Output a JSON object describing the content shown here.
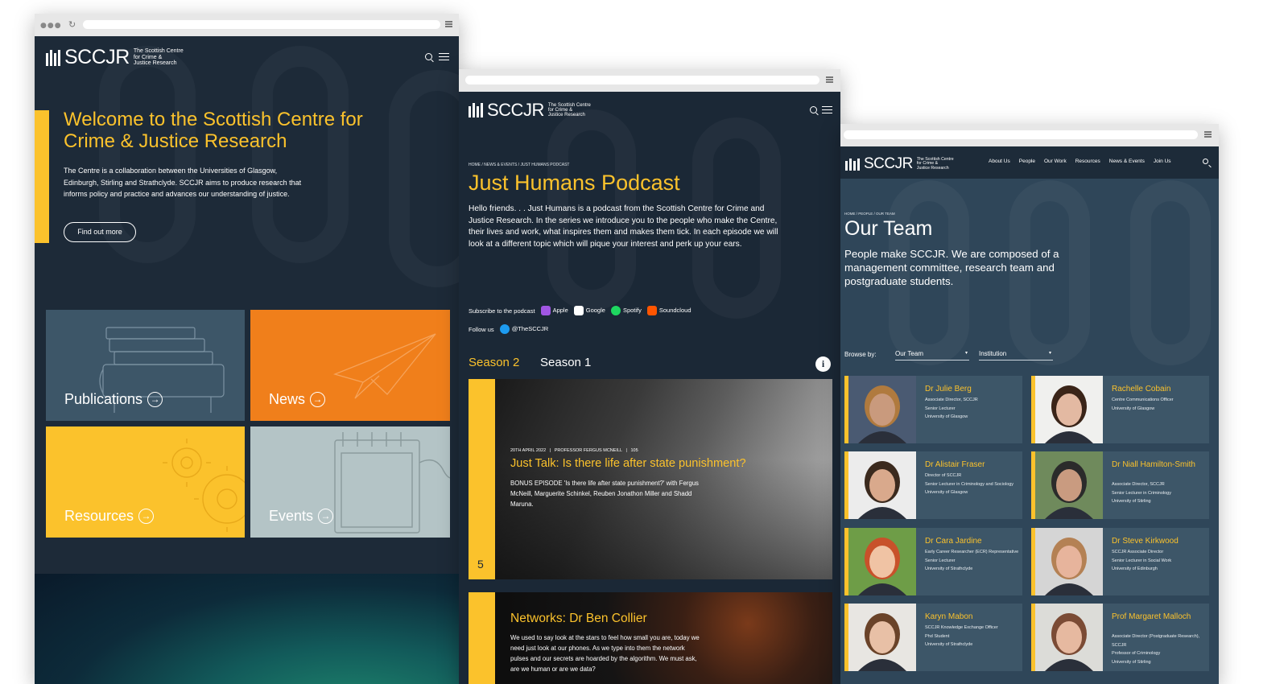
{
  "left": {
    "logo_word": "SCCJR",
    "logo_tag": "The Scottish Centre\nfor Crime &\nJustice Research",
    "heading": "Welcome to the Scottish Centre for Crime & Justice Research",
    "body": "The Centre is a collaboration between the Universities of Glasgow, Edinburgh, Stirling and Strathclyde. SCCJR aims to produce research that informs policy and practice and advances our understanding of justice.",
    "button": "Find out more",
    "tiles": [
      {
        "label": "Publications",
        "icon": "books-icon",
        "color": "#3d5668"
      },
      {
        "label": "News",
        "icon": "paper-plane-icon",
        "color": "#f07f1b"
      },
      {
        "label": "Resources",
        "icon": "gears-icon",
        "color": "#fbc22c"
      },
      {
        "label": "Events",
        "icon": "notepad-icon",
        "color": "#b4c4c6"
      }
    ]
  },
  "middle": {
    "logo_word": "SCCJR",
    "logo_tag": "The Scottish Centre\nfor Crime &\nJustice Research",
    "breadcrumb": "HOME / NEWS & EVENTS / JUST HUMANS PODCAST",
    "title": "Just Humans Podcast",
    "intro": "Hello friends. . . Just Humans is a podcast from the Scottish Centre for Crime and Justice Research. In the series we introduce you to the people who make the Centre, their lives and work, what inspires them and makes them tick. In each episode we will look at a different topic which will pique your interest and perk up your ears.",
    "subscribe_label": "Subscribe to the podcast",
    "platforms": [
      {
        "name": "Apple",
        "icon": "apple-podcasts-icon",
        "color": "#a056e3"
      },
      {
        "name": "Google",
        "icon": "google-podcasts-icon",
        "color": "#ffffff"
      },
      {
        "name": "Spotify",
        "icon": "spotify-icon",
        "color": "#1ed760"
      },
      {
        "name": "Soundcloud",
        "icon": "soundcloud-icon",
        "color": "#ff5500"
      }
    ],
    "follow_label": "Follow us",
    "twitter_handle": "@TheSCCJR",
    "season_active": "Season 2",
    "season_other": "Season 1",
    "episode1": {
      "meta": "20TH APRIL 2022   |   PROFESSOR FERGUS MCNEILL   |   105",
      "title": "Just Talk: Is there life after state punishment?",
      "desc": "BONUS EPISODE 'Is there life after state punishment?' with Fergus McNeill, Marguerite Schinkel, Reuben Jonathon Miller and Shadd Maruna.",
      "number": "5"
    },
    "episode2": {
      "title": "Networks: Dr Ben Collier",
      "desc": "We used to say look at the stars to feel how small you are, today we need just look at our phones. As we type into them the network pulses and our secrets are hoarded by the algorithm. We must ask, are we human or are we data?"
    }
  },
  "right": {
    "logo_word": "SCCJR",
    "logo_tag": "The Scottish Centre\nfor Crime &\nJustice Research",
    "nav": [
      "About Us",
      "People",
      "Our Work",
      "Resources",
      "News & Events",
      "Join Us"
    ],
    "breadcrumb": "HOME / PEOPLE / OUR TEAM",
    "title": "Our Team",
    "intro": "People make SCCJR. We are composed of a management committee, research team and postgraduate students.",
    "browse_label": "Browse by:",
    "filter1": "Our Team",
    "filter2": "Institution",
    "team": [
      {
        "name": "Dr Julie Berg",
        "role": "Associate Director, SCCJR\nSenior Lecturer\nUniversity of Glasgow",
        "skin": "#c99a7d",
        "hair": "#b07a3e",
        "bg": "#4a5a72"
      },
      {
        "name": "Rachelle Cobain",
        "role": "Centre Communications Officer\nUniversity of Glasgow",
        "skin": "#e3b9a2",
        "hair": "#3a2418",
        "bg": "#f0f0ee"
      },
      {
        "name": "Dr Alistair Fraser",
        "role": "Director of SCCJR\nSenior Lecturer in Criminology and Sociology\nUniversity of Glasgow",
        "skin": "#d9a98c",
        "hair": "#3b2a1e",
        "bg": "#ececec"
      },
      {
        "name": "Dr Niall Hamilton-Smith",
        "role": "Associate Director, SCCJR\nSenior Lecturer in Criminology\nUniversity of Stirling",
        "skin": "#c99b80",
        "hair": "#2b2b2b",
        "bg": "#6f8a5c"
      },
      {
        "name": "Dr Cara Jardine",
        "role": "Early Career Researcher (ECR) Representative\nSenior Lecturer\nUniversity of Strathclyde",
        "skin": "#f0c3a4",
        "hair": "#c8512a",
        "bg": "#6e9d47"
      },
      {
        "name": "Dr Steve Kirkwood",
        "role": "SCCJR Associate Director\nSenior Lecturer in Social Work\nUniversity of Edinburgh",
        "skin": "#e7b49c",
        "hair": "#b48154",
        "bg": "#d5d5d5"
      },
      {
        "name": "Karyn Mabon",
        "role": "SCCJR Knowledge Exchange Officer\nPhd Student\nUniversity of Strathclyde",
        "skin": "#e8c0a6",
        "hair": "#6a4329",
        "bg": "#e8e6e2"
      },
      {
        "name": "Prof Margaret Malloch",
        "role": "Associate Director (Postgraduate Research), SCCJR\nProfessor of Criminology\nUniversity of Stirling",
        "skin": "#e6b9a0",
        "hair": "#7b4b35",
        "bg": "#dcdcd8"
      }
    ]
  }
}
